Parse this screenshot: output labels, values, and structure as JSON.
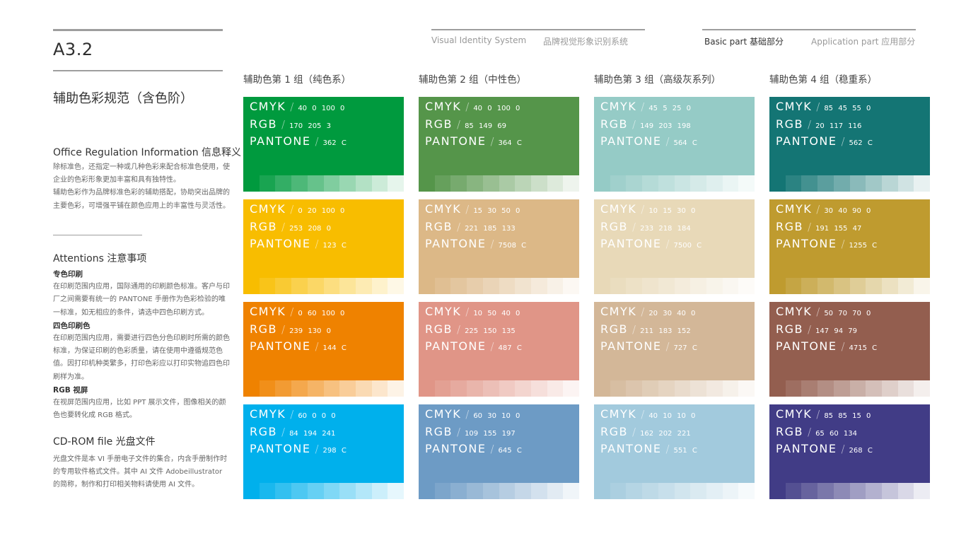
{
  "header": {
    "code": "A3.2",
    "title": "辅助色彩规范（含色阶）",
    "nav": [
      {
        "label": "Visual Identity System",
        "active": false
      },
      {
        "label": "品牌视觉形象识别系统",
        "active": false
      },
      {
        "label": "Basic part  基础部分",
        "active": true
      },
      {
        "label": "Application part  应用部分",
        "active": false
      }
    ]
  },
  "sidebar": {
    "office": {
      "heading": "Office Regulation Information 信息释义",
      "text": "除标准色，还指定一种或几种色彩来配合标准色使用，使企业的色彩形象更加丰富和具有独特性。\n辅助色彩作为品牌标准色彩的辅助搭配，协助突出品牌的主要色彩，可增强平铺在颜色应用上的丰富性与灵活性。"
    },
    "attentions": {
      "heading": "Attentions 注意事项",
      "items": [
        {
          "title": "专色印刷",
          "text": "在印刷范围内应用，国际通用的印刷颜色标准。客户与印厂之间需要有统一的 PANTONE 手册作为色彩检验的唯一标准，如无相应的条件，请选中四色印刷方式。"
        },
        {
          "title": "四色印刷色",
          "text": "在印刷范围内应用，需要进行四色分色印刷时所需的颜色标准，为保证印刷的色彩质量，请在使用中遵循规范色值。因打印机种类繁多，打印色彩应以打印实物追四色印刷样为准。"
        },
        {
          "title": "RGB 视屏",
          "text": "在视屏范围内应用，比如 PPT 展示文件，图像相关的颜色也要转化成 RGB 格式。"
        }
      ]
    },
    "cdrom": {
      "heading": "CD-ROM file 光盘文件",
      "text": "光盘文件是本 VI 手册电子文件的集合，内含手册制作时的专用软件格式文件。其中 AI 文件 Adobeillustrator 的简称，制作和打印相关物料请使用 AI 文件。"
    }
  },
  "labels": {
    "cmyk": "CMYK",
    "rgb": "RGB",
    "pantone": "PANTONE",
    "slash": "/"
  },
  "groups": [
    {
      "title": "辅助色第 1 组（纯色系）",
      "colors": [
        {
          "cmyk": "40  0  100  0",
          "rgb": "170  205  3",
          "pantone": "362 C",
          "hex": "#009a3e"
        },
        {
          "cmyk": "0  20  100  0",
          "rgb": "253  208  0",
          "pantone": "123 C",
          "hex": "#f8bd00"
        },
        {
          "cmyk": "0  60  100  0",
          "rgb": "239  130  0",
          "pantone": "144 C",
          "hex": "#ef8200"
        },
        {
          "cmyk": "60  0  0  0",
          "rgb": "84  194  241",
          "pantone": "298 C",
          "hex": "#00b0ec"
        }
      ]
    },
    {
      "title": "辅助色第 2 组（中性色）",
      "colors": [
        {
          "cmyk": "40  0  100  0",
          "rgb": "85  149  69",
          "pantone": "364 C",
          "hex": "#55954a"
        },
        {
          "cmyk": "15  30  50  0",
          "rgb": "221  185  133",
          "pantone": "7508 C",
          "hex": "#dcb887"
        },
        {
          "cmyk": "10  50  40  0",
          "rgb": "225  150  135",
          "pantone": "487 C",
          "hex": "#e09587"
        },
        {
          "cmyk": "60  30  10  0",
          "rgb": "109  155  197",
          "pantone": "645 C",
          "hex": "#6d9bc5"
        }
      ]
    },
    {
      "title": "辅助色第 3 组（高级灰系列）",
      "colors": [
        {
          "cmyk": "45  5  25  0",
          "rgb": "149  203  198",
          "pantone": "564 C",
          "hex": "#95cbc6"
        },
        {
          "cmyk": "10  15  30  0",
          "rgb": "233  218  184",
          "pantone": "7500 C",
          "hex": "#e8d9b8"
        },
        {
          "cmyk": "20  30  40  0",
          "rgb": "211  183  152",
          "pantone": "727 C",
          "hex": "#d3b798"
        },
        {
          "cmyk": "40  10  10  0",
          "rgb": "162  202  221",
          "pantone": "551 C",
          "hex": "#a2cadd"
        }
      ]
    },
    {
      "title": "辅助色第 4 组（稳重系）",
      "colors": [
        {
          "cmyk": "85  45  55  0",
          "rgb": "20  117  116",
          "pantone": "562 C",
          "hex": "#147574"
        },
        {
          "cmyk": "30  40  90  0",
          "rgb": "191  155  47",
          "pantone": "1255 C",
          "hex": "#bf9b2f"
        },
        {
          "cmyk": "50  70  70  0",
          "rgb": "147  94  79",
          "pantone": "4715 C",
          "hex": "#935e4f"
        },
        {
          "cmyk": "85  85  15  0",
          "rgb": "65  60  134",
          "pantone": "268 C",
          "hex": "#413c86"
        }
      ]
    }
  ],
  "tint_steps": [
    1.0,
    0.9,
    0.8,
    0.7,
    0.6,
    0.5,
    0.4,
    0.3,
    0.2,
    0.1
  ]
}
